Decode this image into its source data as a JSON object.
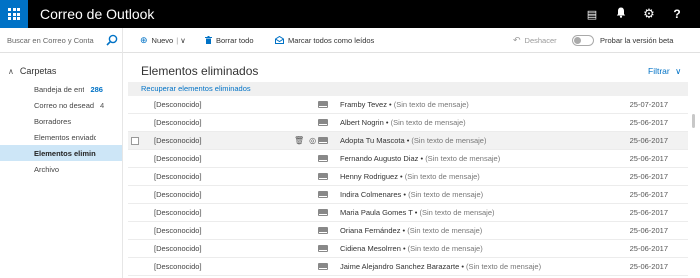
{
  "topbar": {
    "title": "Correo de Outlook",
    "icons": [
      "waffle-icon",
      "chat-icon",
      "bell-icon",
      "gear-icon",
      "help-icon"
    ],
    "chat_glyph": "▤",
    "bell_glyph": "🔔",
    "gear_glyph": "⚙",
    "help_glyph": "?"
  },
  "search": {
    "placeholder": "Buscar en Correo y Conta"
  },
  "commands": {
    "new_label": "Nuevo",
    "new_icon": "⊕",
    "new_caret": "∨",
    "delete_all_label": "Borrar todo",
    "delete_icon": "🗑",
    "mark_read_label": "Marcar todos como leídos",
    "mark_read_icon": "✉",
    "undo_label": "Deshacer",
    "undo_icon": "↶",
    "beta_label": "Probar la versión beta"
  },
  "nav": {
    "header": "Carpetas",
    "chevron": "∧",
    "items": [
      {
        "label": "Bandeja de ent",
        "count": "286"
      },
      {
        "label": "Correo no desead",
        "count": "4"
      },
      {
        "label": "Borradores",
        "count": ""
      },
      {
        "label": "Elementos enviados",
        "count": ""
      },
      {
        "label": "Elementos eliminad",
        "count": ""
      },
      {
        "label": "Archivo",
        "count": ""
      }
    ],
    "selected_index": 4
  },
  "main": {
    "title": "Elementos eliminados",
    "filter_label": "Filtrar",
    "filter_caret": "∨",
    "recover_label": "Recuperar elementos eliminados"
  },
  "messages": [
    {
      "sender": "[Desconocido]",
      "subject": "Framby Tevez",
      "preview": "(Sin texto de mensaje)",
      "date": "25-07-2017"
    },
    {
      "sender": "[Desconocido]",
      "subject": "Albert Nogrin",
      "preview": "(Sin texto de mensaje)",
      "date": "25-06-2017"
    },
    {
      "sender": "[Desconocido]",
      "subject": "Adopta Tu Mascota",
      "preview": "(Sin texto de mensaje)",
      "date": "25-06-2017"
    },
    {
      "sender": "[Desconocido]",
      "subject": "Fernando Augusto Diaz",
      "preview": "(Sin texto de mensaje)",
      "date": "25-06-2017"
    },
    {
      "sender": "[Desconocido]",
      "subject": "Henny Rodriguez",
      "preview": "(Sin texto de mensaje)",
      "date": "25-06-2017"
    },
    {
      "sender": "[Desconocido]",
      "subject": "Indira Colmenares",
      "preview": "(Sin texto de mensaje)",
      "date": "25-06-2017"
    },
    {
      "sender": "[Desconocido]",
      "subject": "Maria Paula Gomes T",
      "preview": "(Sin texto de mensaje)",
      "date": "25-06-2017"
    },
    {
      "sender": "[Desconocido]",
      "subject": "Oriana Fernández",
      "preview": "(Sin texto de mensaje)",
      "date": "25-06-2017"
    },
    {
      "sender": "[Desconocido]",
      "subject": "Cidiena Mesolrren",
      "preview": "(Sin texto de mensaje)",
      "date": "25-06-2017"
    },
    {
      "sender": "[Desconocido]",
      "subject": "Jaime Alejandro Sanchez Barazarte",
      "preview": "(Sin texto de mensaje)",
      "date": "25-06-2017"
    }
  ],
  "row_actions": {
    "delete_icon": "🗑",
    "category_icon": "◎",
    "flag_icon": "⚑"
  },
  "colors": {
    "brand_blue": "#0072c6",
    "topbar": "#000000",
    "selected_folder": "#cde6f7"
  }
}
